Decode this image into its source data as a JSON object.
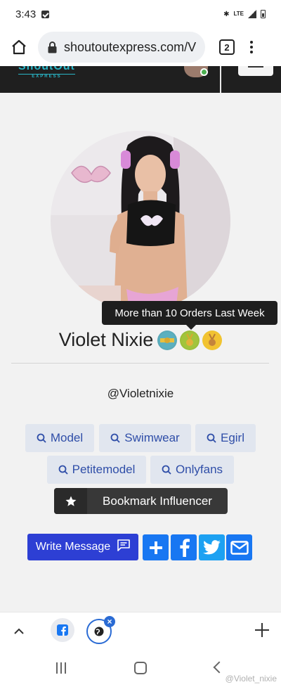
{
  "status_bar": {
    "time": "3:43",
    "network": "LTE"
  },
  "browser": {
    "url": "shoutoutexpress.com/V",
    "tab_count": "2"
  },
  "site_header": {
    "logo_text": "ShoutOut",
    "logo_sub": "EXPRESS"
  },
  "profile": {
    "name": "Violet Nixie",
    "handle": "@Violetnixie",
    "tooltip": "More than 10 Orders Last Week",
    "badges": [
      "verified-badge-icon",
      "gold-medal-icon",
      "bronze-medal-icon"
    ]
  },
  "tags": [
    {
      "label": "Model"
    },
    {
      "label": "Swimwear"
    },
    {
      "label": "Egirl"
    },
    {
      "label": "Petitemodel"
    },
    {
      "label": "Onlyfans"
    }
  ],
  "actions": {
    "bookmark_label": "Bookmark Influencer",
    "write_message_label": "Write Message"
  },
  "colors": {
    "primary_button": "#2d3fd4",
    "tag_text": "#2f4ea8",
    "tag_bg": "#e1e6ef",
    "facebook": "#1877f2",
    "twitter": "#1da1f2",
    "accent_teal": "#29b4c5"
  },
  "watermark": "@Violet_nixie"
}
